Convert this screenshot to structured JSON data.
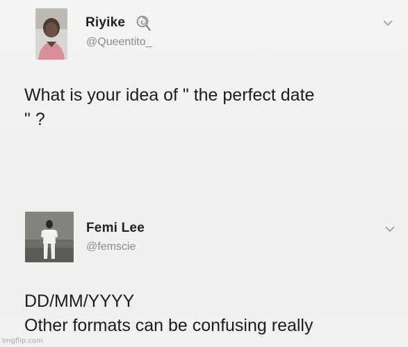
{
  "tweets": [
    {
      "display_name": "Riyike",
      "handle": "@Queentito_",
      "badge_icon": "lollipop-icon",
      "menu_icon": "chevron-down-icon",
      "text_lines": [
        "What is your idea of \" the perfect date",
        "\" ?"
      ]
    },
    {
      "display_name": "Femi Lee",
      "handle": "@femscie",
      "menu_icon": "chevron-down-icon",
      "text_lines": [
        "DD/MM/YYYY",
        "Other formats can be confusing really"
      ]
    }
  ],
  "watermark": "imgflip.com",
  "colors": {
    "background": "#f2f2f0",
    "text": "#1c1c1c",
    "handle": "#8a8a8a"
  }
}
